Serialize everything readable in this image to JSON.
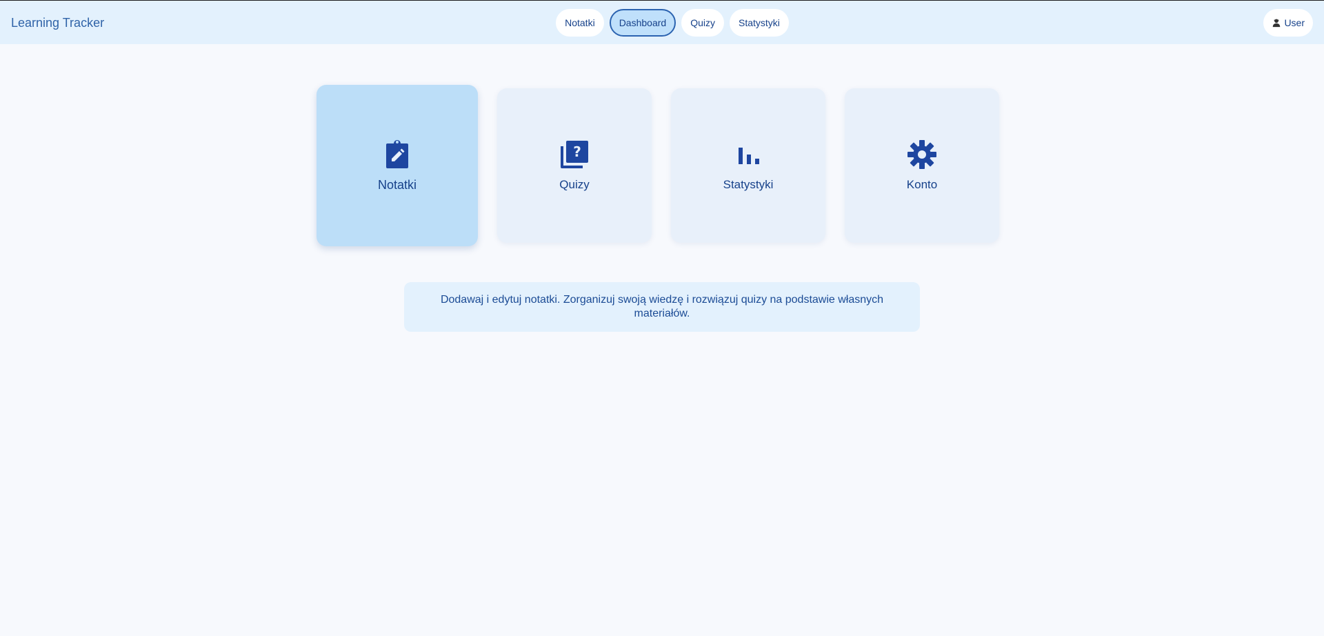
{
  "header": {
    "brand": "Learning Tracker",
    "nav": [
      {
        "label": "Notatki",
        "active": false
      },
      {
        "label": "Dashboard",
        "active": true
      },
      {
        "label": "Quizy",
        "active": false
      },
      {
        "label": "Statystyki",
        "active": false
      }
    ],
    "user": {
      "label": "User",
      "icon": "user-icon"
    }
  },
  "cards": [
    {
      "label": "Notatki",
      "icon": "edit-note-icon",
      "active": true
    },
    {
      "label": "Quizy",
      "icon": "quiz-icon",
      "active": false
    },
    {
      "label": "Statystyki",
      "icon": "bar-chart-icon",
      "active": false
    },
    {
      "label": "Konto",
      "icon": "gear-icon",
      "active": false
    }
  ],
  "info": {
    "text": "Dodawaj i edytuj notatki. Zorganizuj swoją wiedzę i rozwiązuj quizy na podstawie własnych materiałów."
  },
  "colors": {
    "accent": "#16418a",
    "header_bg": "#e3f1fd",
    "card_bg": "#e8f0fa",
    "card_active_bg": "#bcdef8",
    "page_bg": "#f7f9fd"
  }
}
